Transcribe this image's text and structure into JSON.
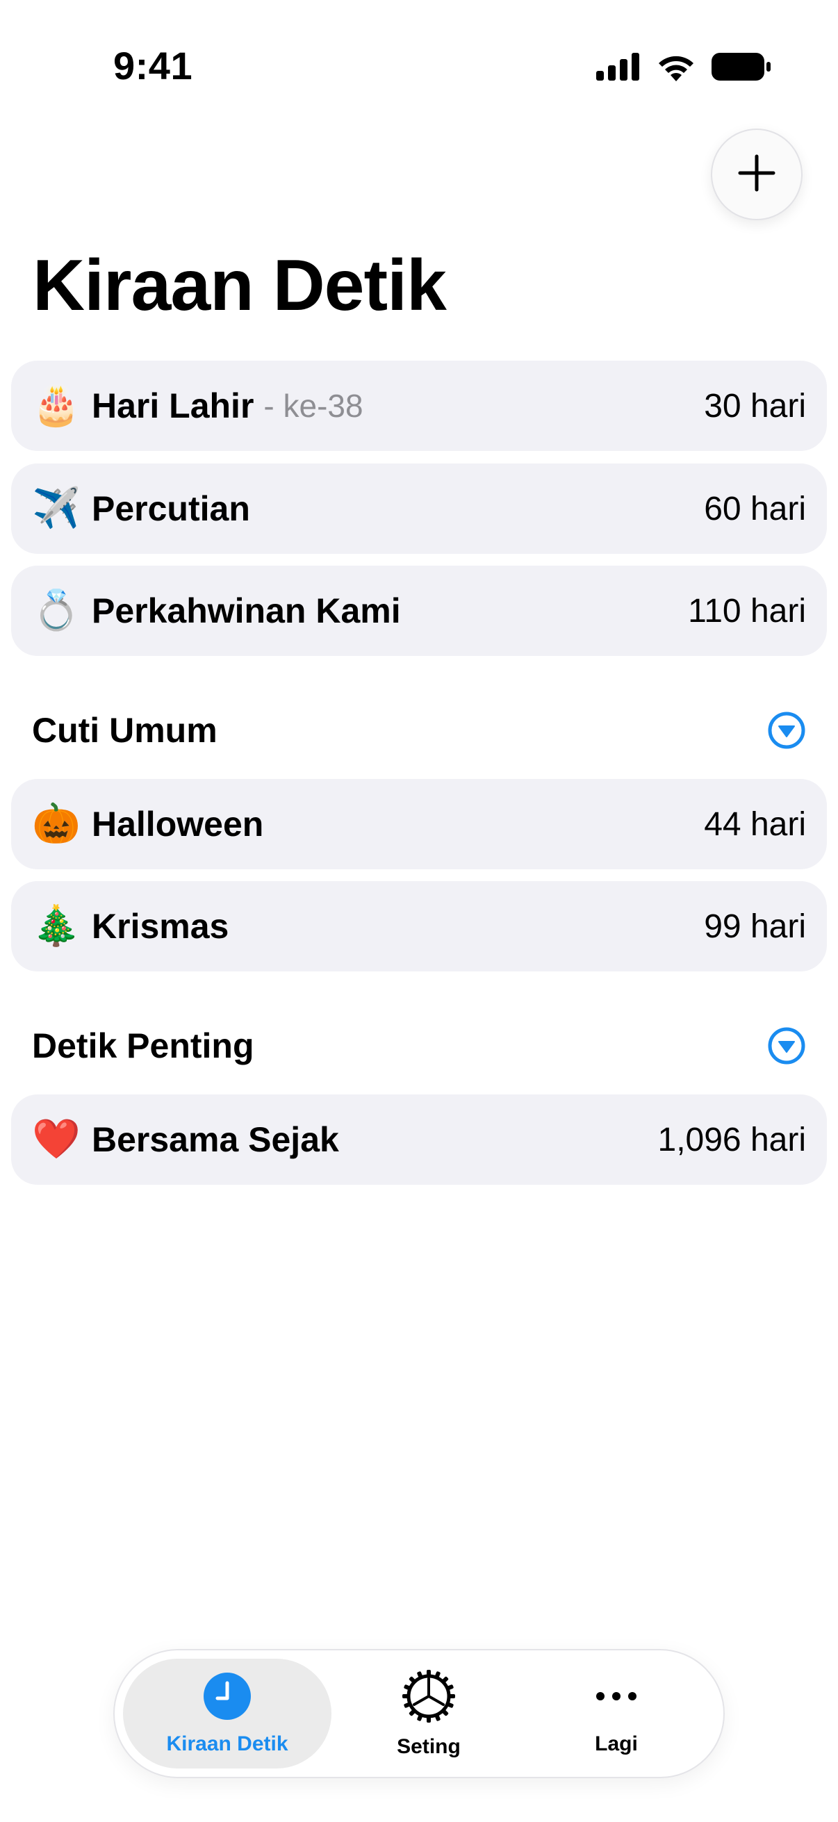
{
  "status_bar": {
    "time": "9:41",
    "icons": [
      "cellular-signal-icon",
      "wifi-icon",
      "battery-icon"
    ]
  },
  "header": {
    "title": "Kiraan Detik",
    "add_icon": "plus-icon"
  },
  "events": [
    {
      "emoji": "🎂",
      "title": "Hari Lahir",
      "subtitle": "- ke-38",
      "value": "30 hari"
    },
    {
      "emoji": "✈️",
      "title": "Percutian",
      "value": "60 hari"
    },
    {
      "emoji": "💍",
      "title": "Perkahwinan Kami",
      "value": "110 hari"
    }
  ],
  "sections": [
    {
      "title": "Cuti Umum",
      "toggle_icon": "chevron-down-circle-icon",
      "items": [
        {
          "emoji": "🎃",
          "title": "Halloween",
          "value": "44 hari"
        },
        {
          "emoji": "🎄",
          "title": "Krismas",
          "value": "99 hari"
        }
      ]
    },
    {
      "title": "Detik Penting",
      "toggle_icon": "chevron-down-circle-icon",
      "items": [
        {
          "emoji": "❤️",
          "title": "Bersama Sejak",
          "value": "1,096 hari"
        }
      ]
    }
  ],
  "tab_bar": {
    "tabs": [
      {
        "label": "Kiraan Detik",
        "icon": "clock-icon",
        "active": true
      },
      {
        "label": "Seting",
        "icon": "gear-icon",
        "active": false
      },
      {
        "label": "Lagi",
        "icon": "more-icon",
        "active": false
      }
    ]
  },
  "colors": {
    "accent": "#1a8cf0",
    "row_background": "#f1f1f6",
    "secondary_text": "#8e8e93"
  }
}
